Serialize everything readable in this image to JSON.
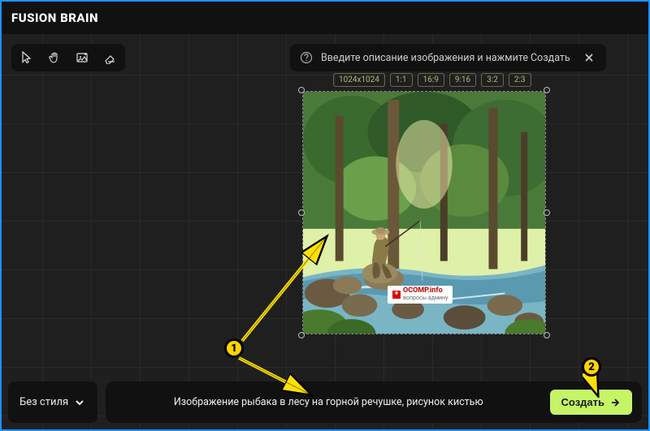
{
  "header": {
    "logo": "FUSION BRAIN"
  },
  "toolbar": {
    "tools": [
      "cursor",
      "hand",
      "image",
      "eraser"
    ]
  },
  "hint": {
    "text": "Введите описание изображения и нажмите Создать"
  },
  "sizes": [
    "1024x1024",
    "1:1",
    "16:9",
    "9:16",
    "3:2",
    "2:3"
  ],
  "badge": {
    "main": "OCOMP.info",
    "sub": "вопросы админу"
  },
  "style_select": {
    "label": "Без стиля"
  },
  "prompt": {
    "text": "Изображение рыбака в лесу на горной речушке, рисунок кистью"
  },
  "create_button": {
    "label": "Создать"
  },
  "annotations": {
    "one": "1",
    "two": "2"
  }
}
